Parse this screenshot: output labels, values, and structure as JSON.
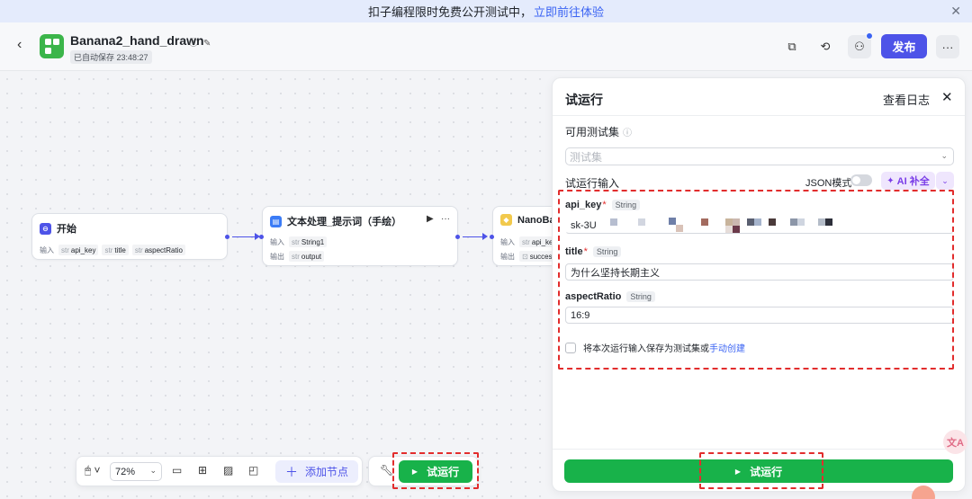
{
  "banner": {
    "text": "扣子编程限时免费公开测试中，",
    "link": "立即前往体验"
  },
  "header": {
    "title": "Banana2_hand_drawn",
    "saved": "已自动保存 23:48:27",
    "publish": "发布",
    "more": "···"
  },
  "nodes": {
    "start": {
      "title": "开始",
      "input_label": "输入",
      "params": [
        "api_key",
        "title",
        "aspectRatio"
      ],
      "type_short": "str"
    },
    "text": {
      "title": "文本处理_提示词（手绘）",
      "input_label": "输入",
      "output_label": "输出",
      "inputs": [
        "String1"
      ],
      "outputs": [
        "output"
      ],
      "type_short": "str"
    },
    "nano": {
      "title": "NanoBa",
      "input_label": "输入",
      "output_label": "输出",
      "inputs": [
        "api_ke"
      ],
      "outputs": [
        "succes"
      ],
      "type_short": "str"
    }
  },
  "toolbar": {
    "zoom": "72%",
    "add_node": "添加节点",
    "run": "试运行"
  },
  "panel": {
    "title": "试运行",
    "view_log": "查看日志",
    "testset_label": "可用测试集",
    "testset_placeholder": "测试集",
    "input_label": "试运行输入",
    "json_mode": "JSON模式",
    "ai_fill": "AI 补全",
    "fields": [
      {
        "name": "api_key",
        "required": true,
        "type": "String",
        "value": "sk-3U"
      },
      {
        "name": "title",
        "required": true,
        "type": "String",
        "value": "为什么坚持长期主义"
      },
      {
        "name": "aspectRatio",
        "required": false,
        "type": "String",
        "value": "16:9"
      }
    ],
    "save_text": "将本次运行输入保存为测试集或",
    "save_link": "手动创建",
    "run_button": "试运行"
  },
  "colors": {
    "brand": "#4d53e8",
    "run": "#18b24a",
    "highlight": "#e22d2d",
    "ai": "#7a3de8"
  }
}
